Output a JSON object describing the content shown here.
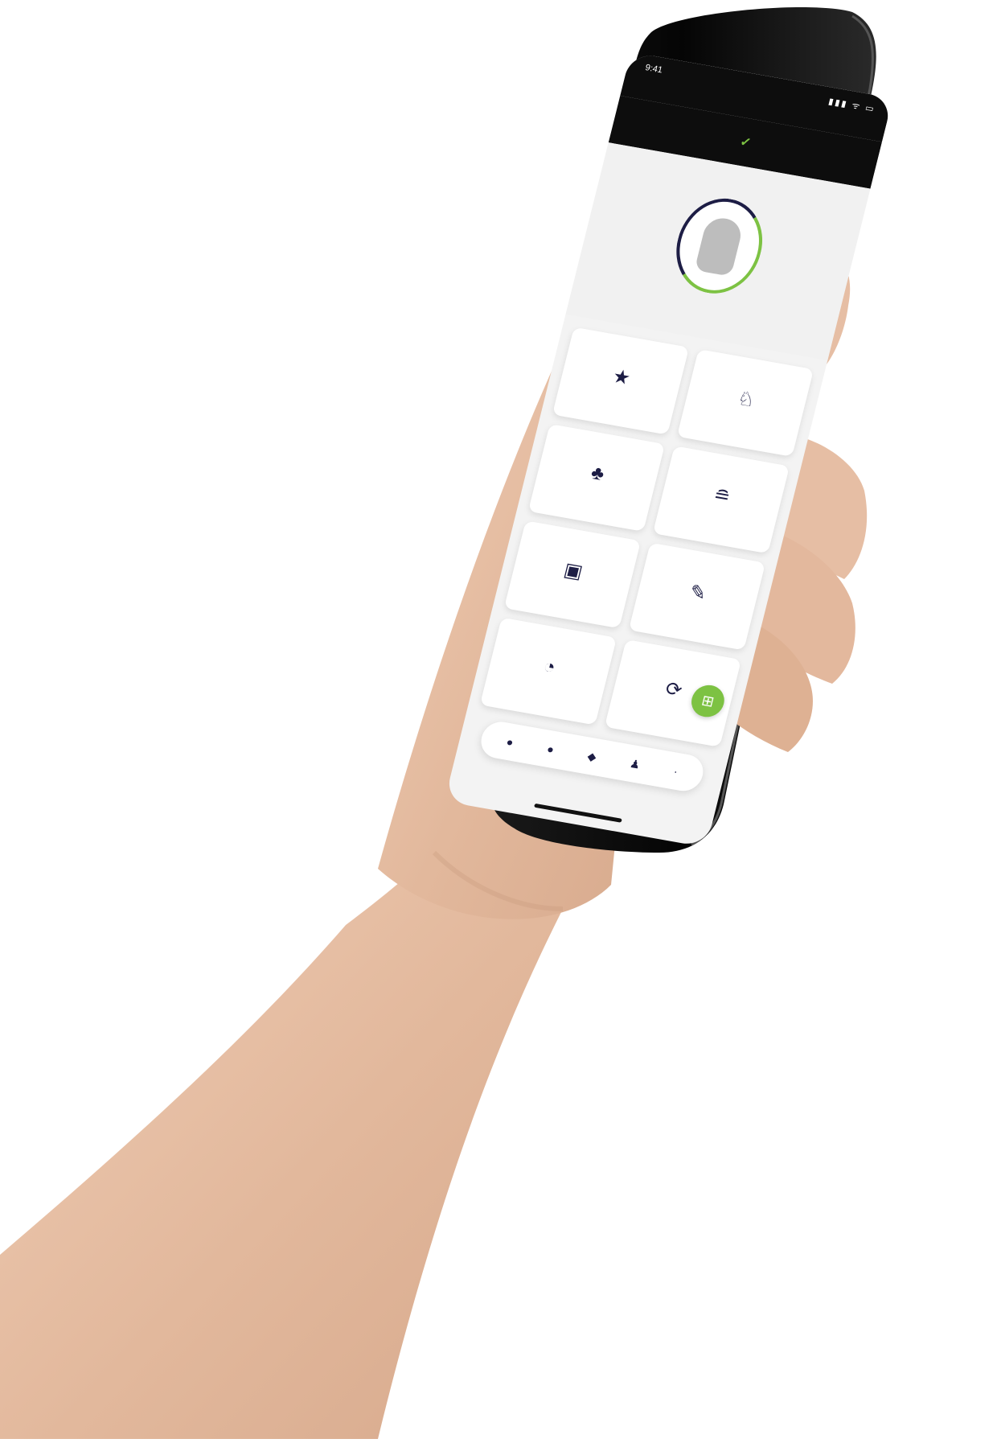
{
  "scene": {
    "description_colors": {
      "skin": "#e8c3ab",
      "phone_body": "#0f0f0f",
      "accent_green": "#7dc243",
      "ui_navy": "#1d1d45"
    }
  },
  "phone": {
    "status_time": "9:41",
    "status_icons": "▮▮▮ ᯤ ▭",
    "logo_text": "",
    "logo_tick": "✓",
    "profile_name": "",
    "tiles": [
      {
        "icon": "★",
        "icon_name": "badge-icon",
        "label": ""
      },
      {
        "icon": "♘",
        "icon_name": "person-icon",
        "label": ""
      },
      {
        "icon": "♣",
        "icon_name": "group-icon",
        "label": ""
      },
      {
        "icon": "≘",
        "icon_name": "list-icon",
        "label": ""
      },
      {
        "icon": "▣",
        "icon_name": "document-icon",
        "label": ""
      },
      {
        "icon": "✎",
        "icon_name": "edit-icon",
        "label": ""
      },
      {
        "icon": "◔",
        "icon_name": "clock-icon",
        "label": ""
      },
      {
        "icon": "⟳",
        "icon_name": "refresh-icon",
        "label": ""
      }
    ],
    "fab_icon": "⊞",
    "nav_icons": [
      "●",
      "●",
      "◆",
      "♟",
      "·"
    ]
  }
}
